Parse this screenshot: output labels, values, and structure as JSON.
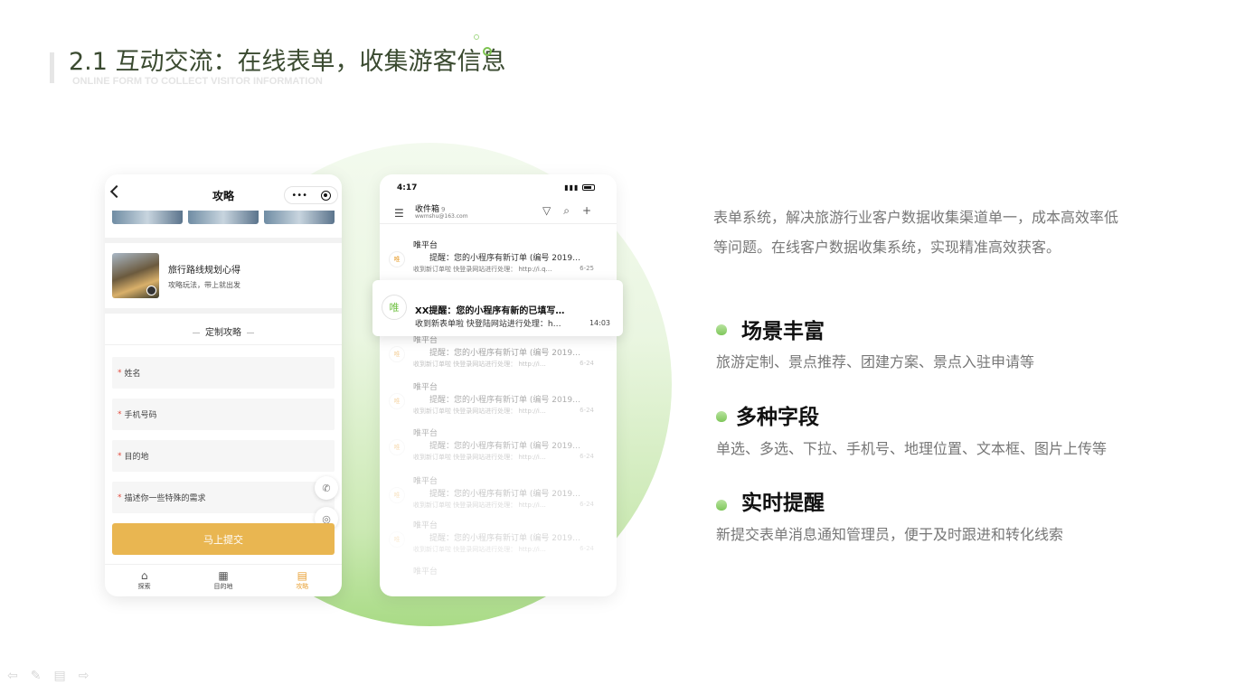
{
  "title": "2.1 互动交流：在线表单，收集游客信息",
  "subtitle": "ONLINE FORM TO COLLECT VISITOR  INFORMATION",
  "colors": {
    "accent_green": "#7cc24f",
    "submit_yellow": "#e9b651"
  },
  "phone1": {
    "title": "攻略",
    "capsule_more": "•••",
    "article": {
      "title": "旅行路线规划心得",
      "sub": "攻略玩法，带上就出发"
    },
    "section_title": "定制攻略",
    "fields": [
      {
        "label": "姓名",
        "required": "*"
      },
      {
        "label": "手机号码",
        "required": "*"
      },
      {
        "label": "目的地",
        "required": "*"
      },
      {
        "label": "描述你一些特殊的需求",
        "required": "*"
      }
    ],
    "submit": "马上提交",
    "tabs": [
      {
        "label": "探索",
        "icon": "home-icon"
      },
      {
        "label": "目的地",
        "icon": "grid-icon"
      },
      {
        "label": "攻略",
        "icon": "document-icon"
      }
    ]
  },
  "phone2": {
    "time": "4:17",
    "inbox": "收件箱",
    "inbox_count": "9",
    "email": "wwmshu@163.com",
    "mails": [
      {
        "from": "唯平台",
        "avatar": "唯",
        "subject": "提醒：您的小程序有新订单 (编号 2019…",
        "preview": "收到新订单啦 快登录网站进行处理： http://i.q…",
        "date": "6-25"
      },
      {
        "from": "唯平台",
        "avatar": "唯",
        "subject": "提醒：您的小程序有新订单 (编号 2019…",
        "preview": "收到新订单啦 快登录网站进行处理： http://i…",
        "date": "6-24"
      },
      {
        "from": "唯平台",
        "avatar": "唯",
        "subject": "提醒：您的小程序有新订单 (编号 2019…",
        "preview": "收到新订单啦 快登录网站进行处理： http://i…",
        "date": "6-24"
      },
      {
        "from": "唯平台",
        "avatar": "唯",
        "subject": "提醒：您的小程序有新订单 (编号 2019…",
        "preview": "收到新订单啦 快登录网站进行处理： http://i…",
        "date": "6-24"
      },
      {
        "from": "唯平台",
        "avatar": "唯",
        "subject": "提醒：您的小程序有新订单 (编号 2019…",
        "preview": "收到新订单啦 快登录网站进行处理： http://i…",
        "date": "6-24"
      },
      {
        "from": "唯平台",
        "avatar": "唯",
        "subject": "提醒：您的小程序有新订单 (编号 2019…",
        "preview": "收到新订单啦 快登录网站进行处理： http://i…",
        "date": "6-24"
      }
    ],
    "last_from": "唯平台",
    "notification": {
      "avatar": "唯",
      "title": "XX提醒：您的小程序有新的已填写…",
      "sub": "收到新表单啦 快登陆网站进行处理：h…",
      "time": "14:03"
    }
  },
  "description": "表单系统，解决旅游行业客户数据收集渠道单一，成本高效率低等问题。在线客户数据收集系统，实现精准高效获客。",
  "features": [
    {
      "title": "场景丰富",
      "desc": "旅游定制、景点推荐、团建方案、景点入驻申请等"
    },
    {
      "title": "多种字段",
      "desc": "单选、多选、下拉、手机号、地理位置、文本框、图片上传等"
    },
    {
      "title": "实时提醒",
      "desc": "新提交表单消息通知管理员，便于及时跟进和转化线索"
    }
  ]
}
